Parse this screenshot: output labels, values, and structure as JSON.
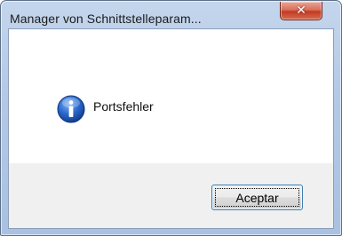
{
  "dialog": {
    "title": "Manager von Schnittstelleparam...",
    "close_glyph": "✕",
    "icon": "info-icon",
    "message": "Portsfehler",
    "ok_label": "Aceptar"
  },
  "colors": {
    "titlebar": "#b3c9e6",
    "close_button": "#c33a22",
    "client_background": "#f0f0f0",
    "content_background": "#ffffff",
    "info_icon": "#1e56b8"
  }
}
